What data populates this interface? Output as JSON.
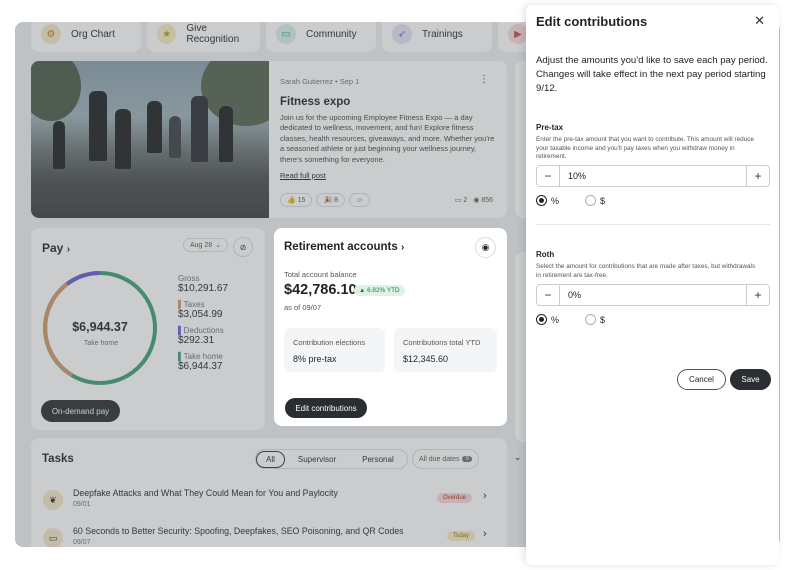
{
  "shortcuts": [
    {
      "label": "Org Chart",
      "icon": "org-chart-icon",
      "glyph": "⚙"
    },
    {
      "label": "Give Recognition",
      "icon": "star-icon",
      "glyph": "★"
    },
    {
      "label": "Community",
      "icon": "chat-icon",
      "glyph": "▭"
    },
    {
      "label": "Trainings",
      "icon": "rocket-icon",
      "glyph": "➶"
    },
    {
      "label": "",
      "icon": "video-icon",
      "glyph": "▶"
    }
  ],
  "post": {
    "author_date": "Sarah Gutierrez • Sep 1",
    "title": "Fitness expo",
    "body": "Join us for the upcoming Employee Fitness Expo — a day dedicated to wellness, movement, and fun! Explore fitness classes, health resources, giveaways, and more. Whether you're a seasoned athlete or just beginning your wellness journey, there's something for everyone.",
    "read_more": "Read full post",
    "reaction1": "👍 15",
    "reaction2": "🎉 8",
    "comments": "2",
    "views": "856"
  },
  "pay": {
    "title": "Pay",
    "date_filter": "Aug 28",
    "center_value": "$6,944.37",
    "center_label": "Take home",
    "gross_label": "Gross",
    "gross_value": "$10,291.67",
    "taxes_label": "Taxes",
    "taxes_value": "$3,054.99",
    "deductions_label": "Deductions",
    "deductions_value": "$292.31",
    "takehome_label": "Take home",
    "takehome_value": "$6,944.37",
    "ondemand_button": "On-demand pay",
    "colors": {
      "gross": "#3f9e7a",
      "taxes": "#d19a66",
      "deductions": "#6b5bd6"
    }
  },
  "retirement": {
    "title": "Retirement accounts",
    "balance_label": "Total account balance",
    "balance_value": "$42,786.10",
    "ytd_badge": "▲ 6.82% YTD",
    "as_of": "as of 09/07",
    "elections_label": "Contribution elections",
    "elections_value": "8% pre-tax",
    "total_label": "Contributions total YTD",
    "total_value": "$12,345.60",
    "edit_button": "Edit contributions"
  },
  "tasks": {
    "title": "Tasks",
    "filters": [
      "All",
      "Supervisor",
      "Personal"
    ],
    "due_filter": "All due dates",
    "due_count": "9",
    "items": [
      {
        "title": "Deepfake Attacks and What They Could Mean for You and Paylocity",
        "date": "09/01",
        "badge": "Overdue"
      },
      {
        "title": "60 Seconds to Better Security: Spoofing, Deepfakes, SEO Poisoning, and QR Codes",
        "date": "09/07",
        "badge": "Today"
      }
    ]
  },
  "panel": {
    "title": "Edit contributions",
    "intro": "Adjust the amounts you'd like to save each pay period. Changes will take effect in the next pay period starting 9/12.",
    "pretax": {
      "label": "Pre-tax",
      "desc": "Enter the pre-tax amount that you want to contribute. This amount will reduce your taxable income and you'll pay taxes when you withdraw money in retirement.",
      "value": "10%",
      "opt_percent": "%",
      "opt_dollar": "$"
    },
    "roth": {
      "label": "Roth",
      "desc": "Select the amount for contributions that are made after taxes, but withdrawals in retirement are tax-free.",
      "value": "0%",
      "opt_percent": "%",
      "opt_dollar": "$"
    },
    "cancel": "Cancel",
    "save": "Save"
  }
}
